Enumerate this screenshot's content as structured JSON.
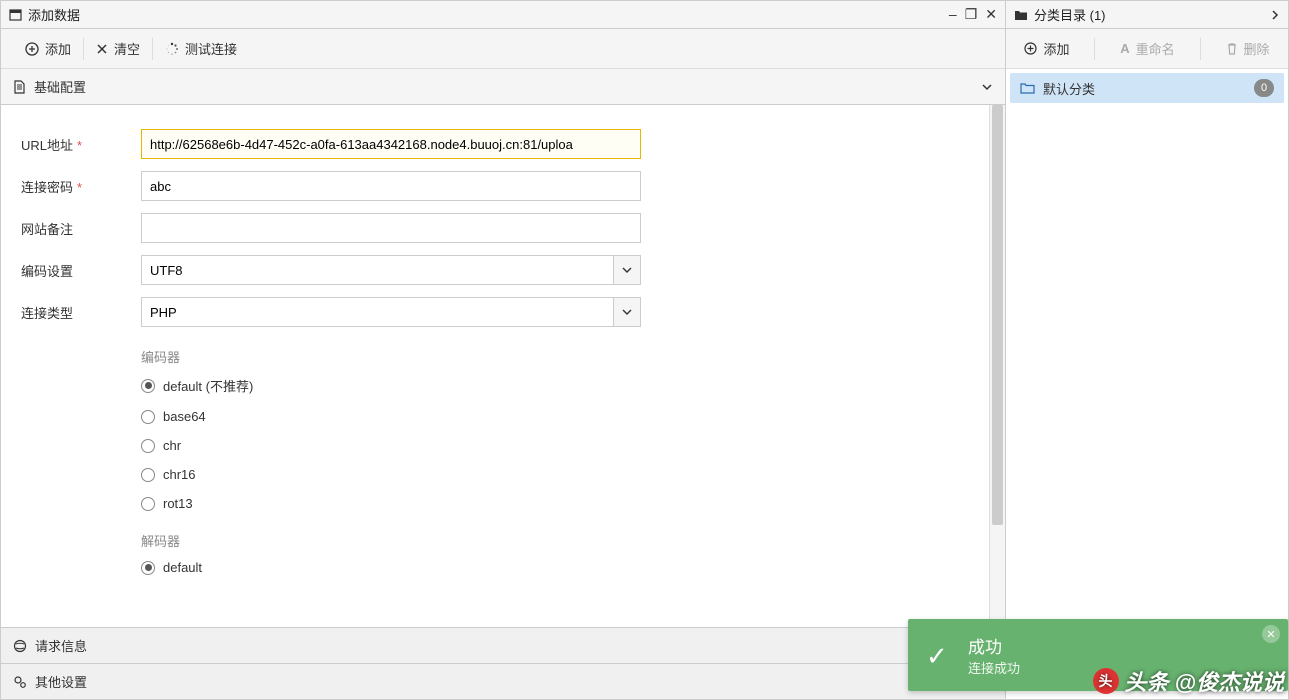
{
  "window": {
    "title": "添加数据"
  },
  "toolbar": {
    "add": "添加",
    "clear": "清空",
    "test_conn": "测试连接"
  },
  "sections": {
    "basic_config": "基础配置",
    "request_info": "请求信息",
    "other_settings": "其他设置"
  },
  "form": {
    "url_label": "URL地址",
    "url_value": "http://62568e6b-4d47-452c-a0fa-613aa4342168.node4.buuoj.cn:81/uploa",
    "password_label": "连接密码",
    "password_value": "abc",
    "note_label": "网站备注",
    "note_value": "",
    "encoding_label": "编码设置",
    "encoding_value": "UTF8",
    "conn_type_label": "连接类型",
    "conn_type_value": "PHP",
    "encoder_label": "编码器",
    "encoders": [
      {
        "label": "default (不推荐)",
        "checked": true
      },
      {
        "label": "base64",
        "checked": false
      },
      {
        "label": "chr",
        "checked": false
      },
      {
        "label": "chr16",
        "checked": false
      },
      {
        "label": "rot13",
        "checked": false
      }
    ],
    "decoder_label": "解码器",
    "decoders": [
      {
        "label": "default",
        "checked": true
      }
    ]
  },
  "sidebar": {
    "title": "分类目录 (1)",
    "add": "添加",
    "rename": "重命名",
    "delete": "删除",
    "items": [
      {
        "label": "默认分类",
        "count": "0"
      }
    ]
  },
  "toast": {
    "title": "成功",
    "message": "连接成功"
  },
  "watermark": {
    "prefix": "头条",
    "handle": "@俊杰说说"
  }
}
